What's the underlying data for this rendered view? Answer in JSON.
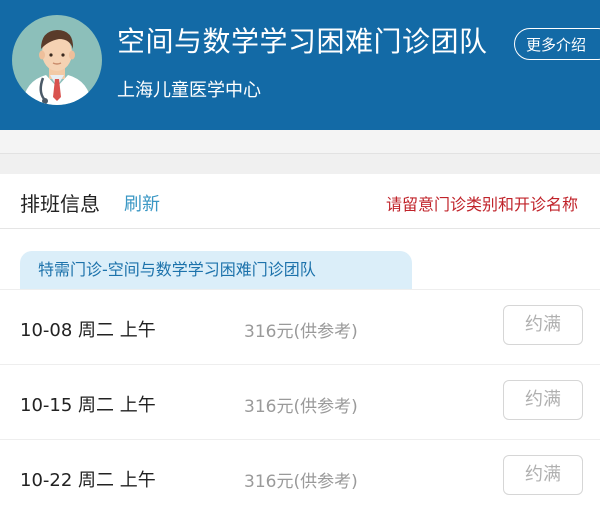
{
  "header": {
    "title": "空间与数学学习困难门诊团队",
    "subtitle": "上海儿童医学中心",
    "more_label": "更多介绍"
  },
  "schedule": {
    "title": "排班信息",
    "refresh_label": "刷新",
    "notice": "请留意门诊类别和开诊名称",
    "clinic_tab": "特需门诊-空间与数学学习困难门诊团队",
    "rows": [
      {
        "date": "10-08 周二 上午",
        "price": "316元(供参考)",
        "status": "约满"
      },
      {
        "date": "10-15 周二 上午",
        "price": "316元(供参考)",
        "status": "约满"
      },
      {
        "date": "10-22 周二 上午",
        "price": "316元(供参考)",
        "status": "约满"
      }
    ]
  },
  "colors": {
    "header_bg": "#136aa6",
    "accent_link": "#3a97c4",
    "notice_red": "#c0232a",
    "tab_bg": "#dbeef9"
  },
  "icons": {
    "avatar": "doctor-avatar-icon"
  }
}
